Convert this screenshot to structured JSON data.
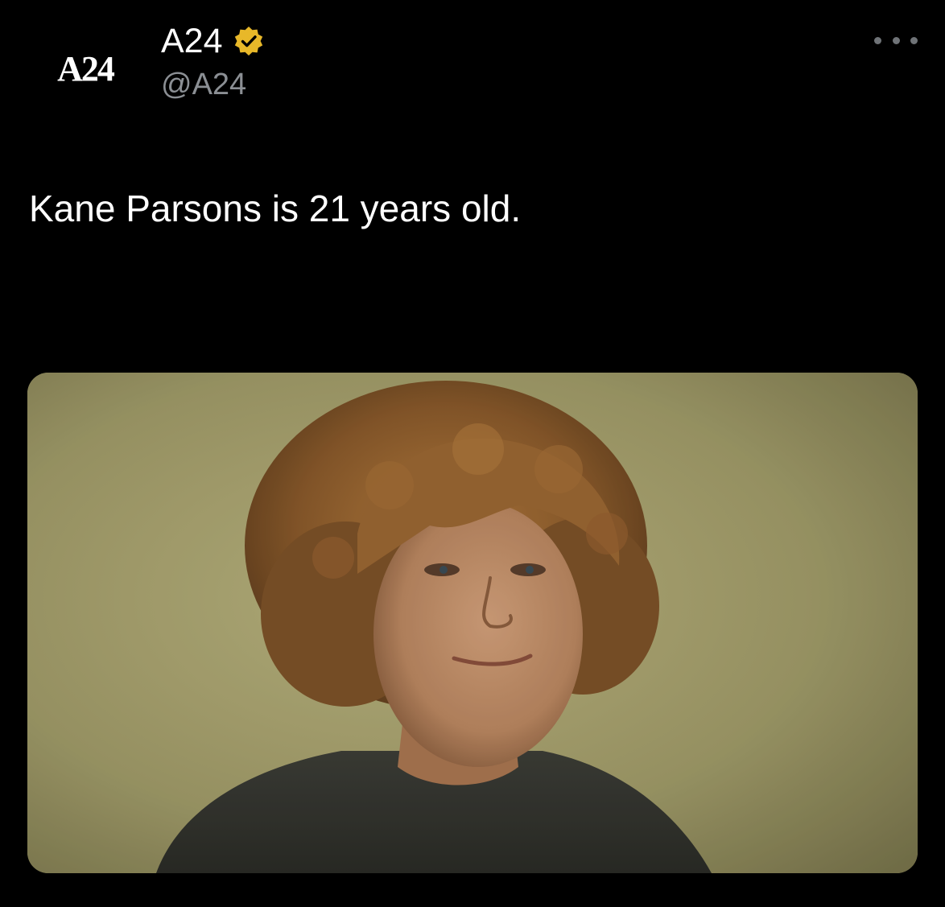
{
  "post": {
    "avatar_text": "A24",
    "display_name": "A24",
    "handle": "@A24",
    "text": "Kane Parsons is 21 years old.",
    "icons": {
      "verified": "verified-badge-icon",
      "more": "more-options-icon"
    },
    "colors": {
      "background": "#000000",
      "verified_gold": "#e8b829",
      "handle_gray": "#8b8f94"
    }
  }
}
